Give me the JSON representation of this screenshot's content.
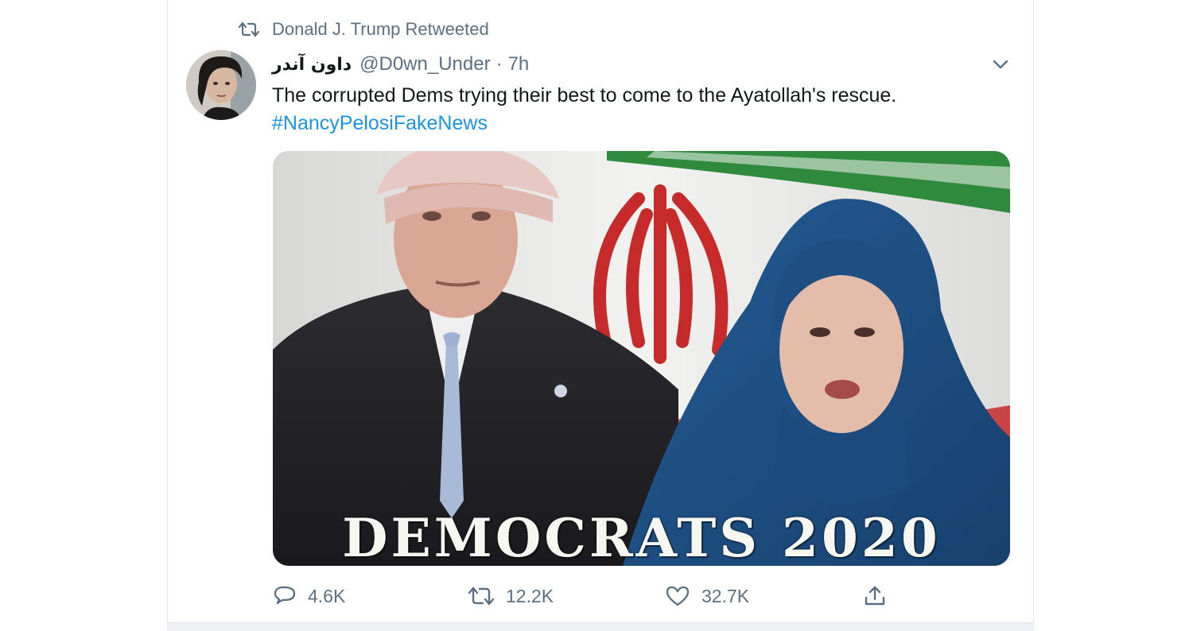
{
  "retweet_context": {
    "label": "Donald J. Trump Retweeted",
    "icon": "retweet-icon"
  },
  "tweet": {
    "display_name": "داون آندر",
    "handle": "@D0wn_Under",
    "separator": "·",
    "time": "7h",
    "text": "The corrupted Dems trying their best to come to the Ayatollah's rescue.",
    "hashtag": "#NancyPelosiFakeNews",
    "media": {
      "caption": "DEMOCRATS 2020"
    },
    "actions": {
      "replies": "4.6K",
      "retweets": "12.2K",
      "likes": "32.7K"
    }
  },
  "colors": {
    "accent_link": "#1b95e0",
    "secondary_text": "#5b7083",
    "primary_text": "#14171a"
  }
}
